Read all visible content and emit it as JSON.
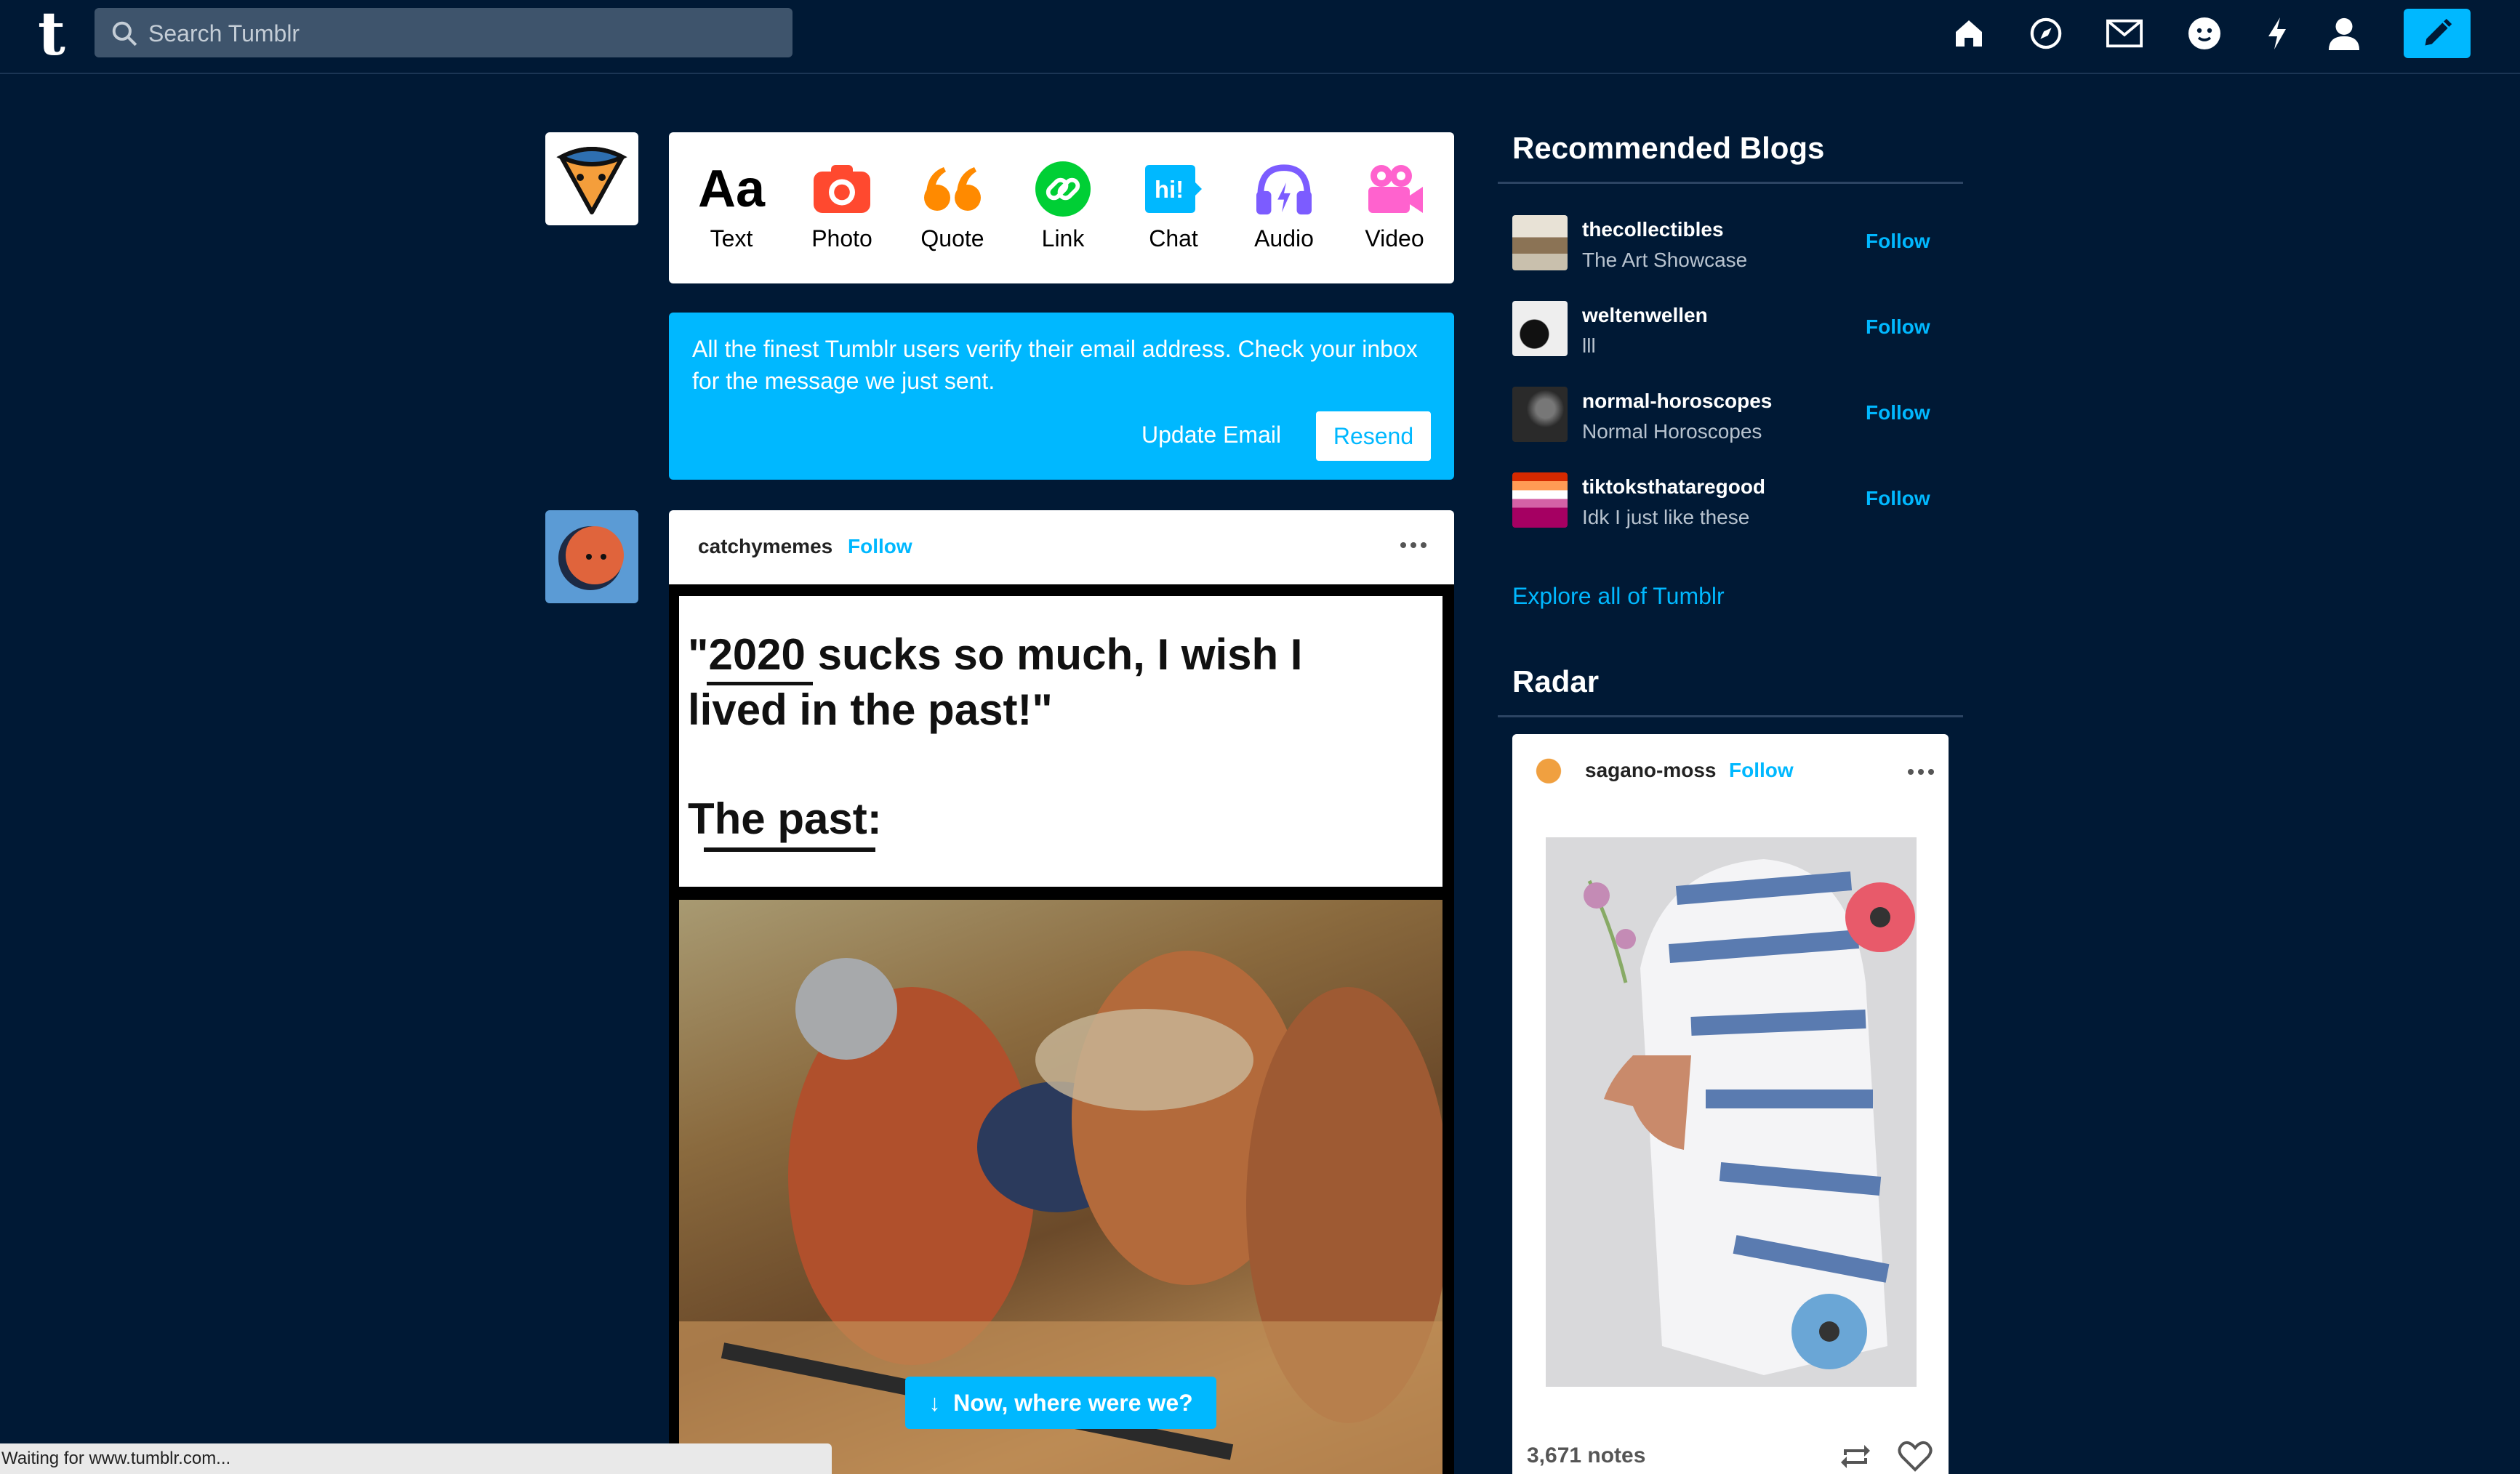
{
  "header": {
    "logo": "t",
    "search_placeholder": "Search Tumblr",
    "nav_icons": [
      "home-icon",
      "explore-icon",
      "inbox-icon",
      "messaging-icon",
      "activity-icon",
      "account-icon"
    ],
    "compose_icon": "pencil-icon"
  },
  "post_types": [
    {
      "label": "Text",
      "icon": "text-icon",
      "color": "#000000"
    },
    {
      "label": "Photo",
      "icon": "camera-icon",
      "color": "#ff492f"
    },
    {
      "label": "Quote",
      "icon": "quote-icon",
      "color": "#ff8a00"
    },
    {
      "label": "Link",
      "icon": "link-icon",
      "color": "#00cf35"
    },
    {
      "label": "Chat",
      "icon": "chat-icon",
      "color": "#00b8ff"
    },
    {
      "label": "Audio",
      "icon": "headphones-icon",
      "color": "#7c5cff"
    },
    {
      "label": "Video",
      "icon": "video-camera-icon",
      "color": "#ff62ce"
    }
  ],
  "verify": {
    "message": "All the finest Tumblr users verify their email address. Check your inbox for the message we just sent.",
    "update_label": "Update Email",
    "resend_label": "Resend"
  },
  "post": {
    "username": "catchymemes",
    "follow_label": "Follow",
    "meme_line1": "\"2020 sucks so much, I wish I",
    "meme_line2": "lived in the past!\"",
    "meme_line3": "The past:"
  },
  "toast": "Now, where were we?",
  "status_bar": "Waiting for www.tumblr.com...",
  "sidebar": {
    "recommended_title": "Recommended Blogs",
    "blogs": [
      {
        "name": "thecollectibles",
        "subtitle": "The Art Showcase",
        "follow": "Follow"
      },
      {
        "name": "weltenwellen",
        "subtitle": "lll",
        "follow": "Follow"
      },
      {
        "name": "normal-horoscopes",
        "subtitle": "Normal Horoscopes",
        "follow": "Follow"
      },
      {
        "name": "tiktoksthataregood",
        "subtitle": "Idk I just like these",
        "follow": "Follow"
      }
    ],
    "explore_label": "Explore all of Tumblr",
    "radar_title": "Radar",
    "radar": {
      "username": "sagano-moss",
      "follow_label": "Follow",
      "notes": "3,671 notes"
    }
  },
  "colors": {
    "background": "#001935",
    "accent": "#00b8ff",
    "white": "#ffffff"
  }
}
